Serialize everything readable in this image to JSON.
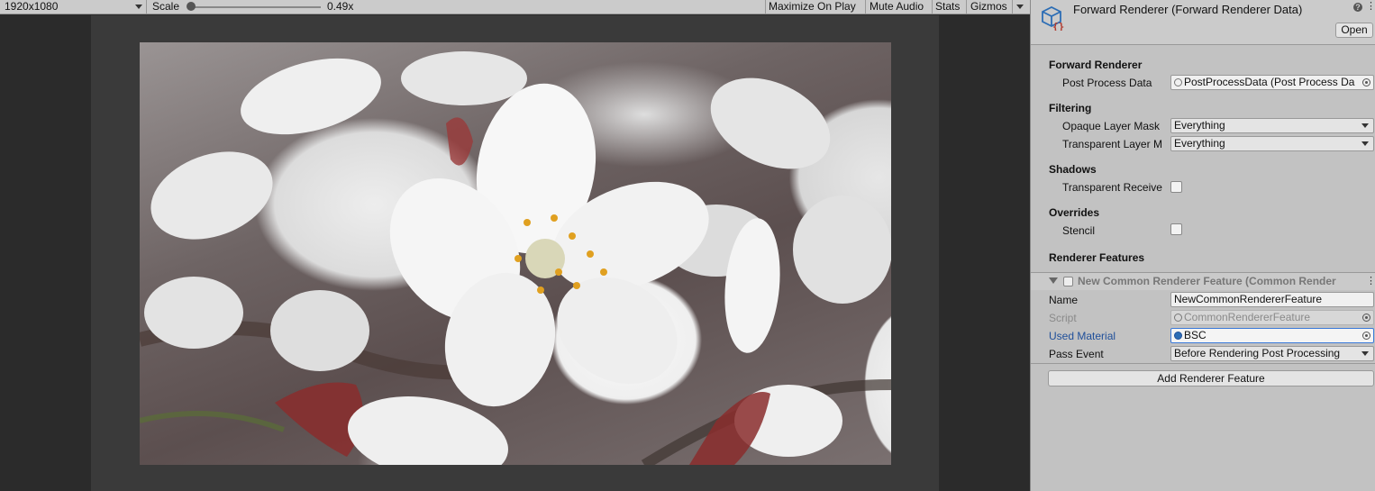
{
  "game_view": {
    "resolution": "1920x1080",
    "scale_label": "Scale",
    "scale_value": "0.49x",
    "scale_level": 0.0,
    "buttons": {
      "maximize": "Maximize On Play",
      "mute": "Mute Audio",
      "stats": "Stats",
      "gizmos": "Gizmos"
    },
    "icons": [
      "resolution-caret-icon",
      "gizmos-caret-icon"
    ],
    "image": "cherry-blossom-photo"
  },
  "inspector": {
    "title": "Forward Renderer (Forward Renderer Data)",
    "help_glyph": "?",
    "menu_glyph": "⋮",
    "open_button": "Open",
    "sections": {
      "forward_renderer": {
        "heading": "Forward Renderer",
        "post_process_label": "Post Process Data",
        "post_process_value": "PostProcessData (Post Process Da"
      },
      "filtering": {
        "heading": "Filtering",
        "opaque_label": "Opaque Layer Mask",
        "opaque_value": "Everything",
        "transparent_label": "Transparent Layer M",
        "transparent_value": "Everything"
      },
      "shadows": {
        "heading": "Shadows",
        "receive_label": "Transparent Receive",
        "receive_checked": false
      },
      "overrides": {
        "heading": "Overrides",
        "stencil_label": "Stencil",
        "stencil_checked": false
      },
      "renderer_features": {
        "heading": "Renderer Features"
      }
    },
    "feature": {
      "title": "New Common Renderer Feature (Common Render",
      "enabled": false,
      "name_label": "Name",
      "name_value": "NewCommonRendererFeature",
      "script_label": "Script",
      "script_value": "CommonRendererFeature",
      "material_label": "Used Material",
      "material_value": "BSC",
      "pass_event_label": "Pass Event",
      "pass_event_value": "Before Rendering Post Processing"
    },
    "add_feature_button": "Add Renderer Feature",
    "colors": {
      "label_highlight": "#1f4f9a",
      "focus_border": "#3a79d9",
      "asset_icon_blue": "#2c6db5",
      "asset_icon_red": "#b03a2e"
    }
  }
}
